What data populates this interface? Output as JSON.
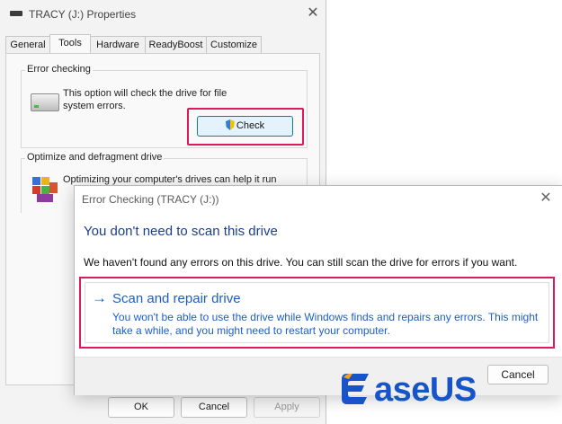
{
  "properties_window": {
    "title": "TRACY (J:) Properties",
    "tabs": [
      "General",
      "Tools",
      "Hardware",
      "ReadyBoost",
      "Customize"
    ],
    "active_tab": "Tools",
    "error_checking": {
      "group_label": "Error checking",
      "description": "This option will check the drive for file system errors.",
      "check_button": "Check"
    },
    "optimize": {
      "group_label": "Optimize and defragment drive",
      "description": "Optimizing your computer's drives can help it run"
    },
    "buttons": {
      "ok": "OK",
      "cancel": "Cancel",
      "apply": "Apply"
    }
  },
  "error_dialog": {
    "title": "Error Checking (TRACY (J:))",
    "heading": "You don't need to scan this drive",
    "body": "We haven't found any errors on this drive. You can still scan the drive for errors if you want.",
    "scan_option": {
      "arrow": "→",
      "title": "Scan and repair drive",
      "description": "You won't be able to use the drive while Windows finds and repairs any errors. This might take a while, and you might need to restart your computer."
    },
    "cancel_button": "Cancel"
  },
  "watermark": {
    "text": "aseUS"
  },
  "colors": {
    "highlight": "#e0195a",
    "link_blue": "#1b5fc4",
    "heading_blue": "#1b3f8c",
    "brand_blue": "#1655c9"
  }
}
